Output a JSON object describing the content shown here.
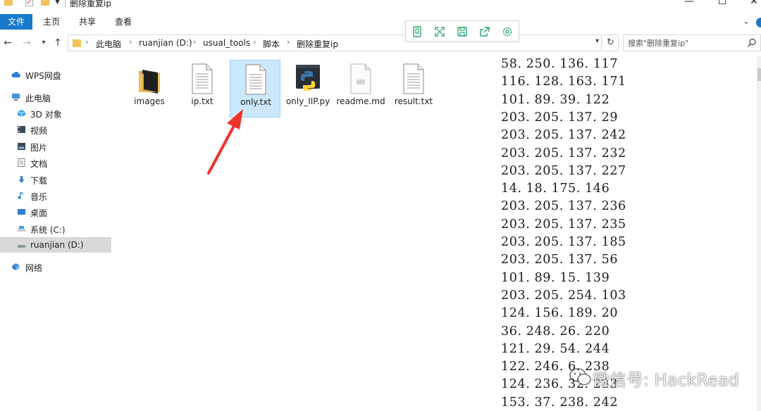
{
  "window": {
    "title": "删除重复ip"
  },
  "ribbon": {
    "tabs": [
      "文件",
      "主页",
      "共享",
      "查看"
    ]
  },
  "floating_toolbar": {
    "icons": [
      "copy-icon",
      "fullscreen-icon",
      "save-icon",
      "share-icon",
      "settings-icon"
    ],
    "accent_color": "#2ea36a"
  },
  "address_bar": {
    "breadcrumbs": [
      "此电脑",
      "ruanjian (D:)",
      "usual_tools",
      "脚本",
      "删除重复ip"
    ]
  },
  "search": {
    "placeholder": "搜索\"删除重复ip\""
  },
  "sidebar": {
    "items": [
      {
        "label": "WPS网盘",
        "icon": "cloud-icon"
      },
      {
        "label": "此电脑",
        "icon": "computer-icon"
      },
      {
        "label": "3D 对象",
        "icon": "cube-icon"
      },
      {
        "label": "视频",
        "icon": "video-icon"
      },
      {
        "label": "图片",
        "icon": "picture-icon"
      },
      {
        "label": "文档",
        "icon": "document-icon"
      },
      {
        "label": "下载",
        "icon": "download-icon"
      },
      {
        "label": "音乐",
        "icon": "music-icon"
      },
      {
        "label": "桌面",
        "icon": "desktop-icon"
      },
      {
        "label": "系统 (C:)",
        "icon": "drive-icon"
      },
      {
        "label": "ruanjian (D:)",
        "icon": "drive-icon"
      },
      {
        "label": "网络",
        "icon": "network-icon"
      }
    ]
  },
  "files": [
    {
      "name": "images",
      "icon": "folder-icon"
    },
    {
      "name": "ip.txt",
      "icon": "text-file-icon"
    },
    {
      "name": "only.txt",
      "icon": "text-file-icon",
      "selected": true
    },
    {
      "name": "only_IIP.py",
      "icon": "python-file-icon"
    },
    {
      "name": "readme.md",
      "icon": "markdown-file-icon"
    },
    {
      "name": "result.txt",
      "icon": "text-file-icon"
    }
  ],
  "preview": {
    "lines": [
      "58. 250. 136. 117",
      "116. 128. 163. 171",
      "101. 89. 39. 122",
      "203. 205. 137. 29",
      "203. 205. 137. 242",
      "203. 205. 137. 232",
      "203. 205. 137. 227",
      "14. 18. 175. 146",
      "203. 205. 137. 236",
      "203. 205. 137. 235",
      "203. 205. 137. 185",
      "203. 205. 137. 56",
      "101. 89. 15. 139",
      "203. 205. 254. 103",
      "124. 156. 189. 20",
      "36. 248. 26. 220",
      "121. 29. 54. 244",
      "122. 246. 6. 238",
      "124. 236. 32. 233",
      "153. 37. 238. 242"
    ]
  },
  "watermark": {
    "text": "微信号: HackRead"
  },
  "colors": {
    "accent": "#1979ca",
    "selection": "#cce8ff",
    "annotation_arrow": "#f0322b"
  }
}
